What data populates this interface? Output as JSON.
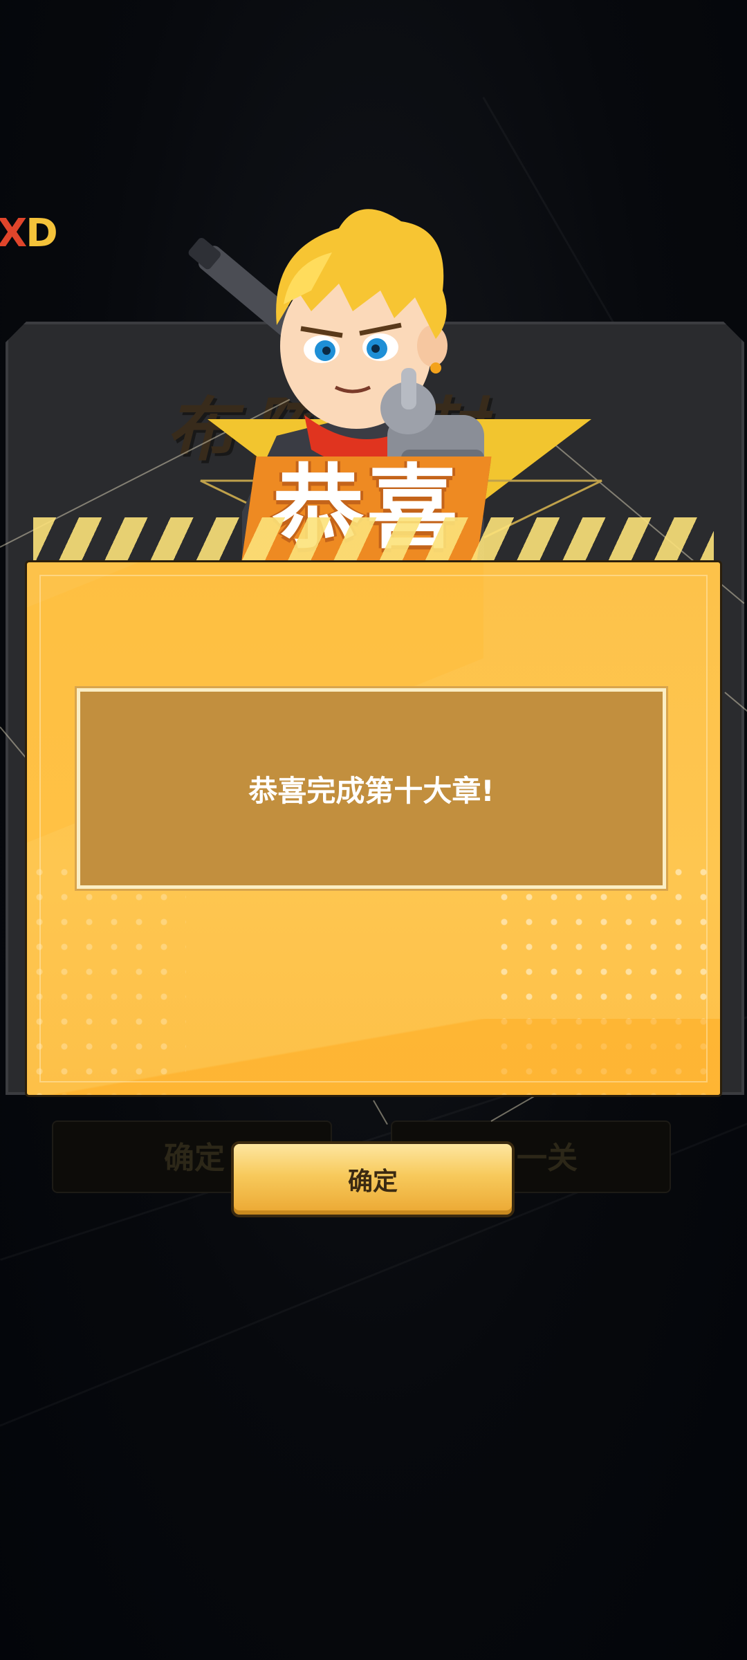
{
  "corner_logo": {
    "part1": "X",
    "part2": "D"
  },
  "background": {
    "panel_title": "布阵阵封",
    "left_button": "确定",
    "right_button": "一关"
  },
  "dialog": {
    "title": "恭喜",
    "message": "恭喜完成第十大章!",
    "confirm_label": "确定"
  },
  "colors": {
    "accent_yellow": "#fec650",
    "title_orange": "#ee8a22",
    "message_bg": "#c28f3e",
    "background": "#05070b"
  },
  "icons": {
    "hero": "hero-character-with-gun"
  }
}
